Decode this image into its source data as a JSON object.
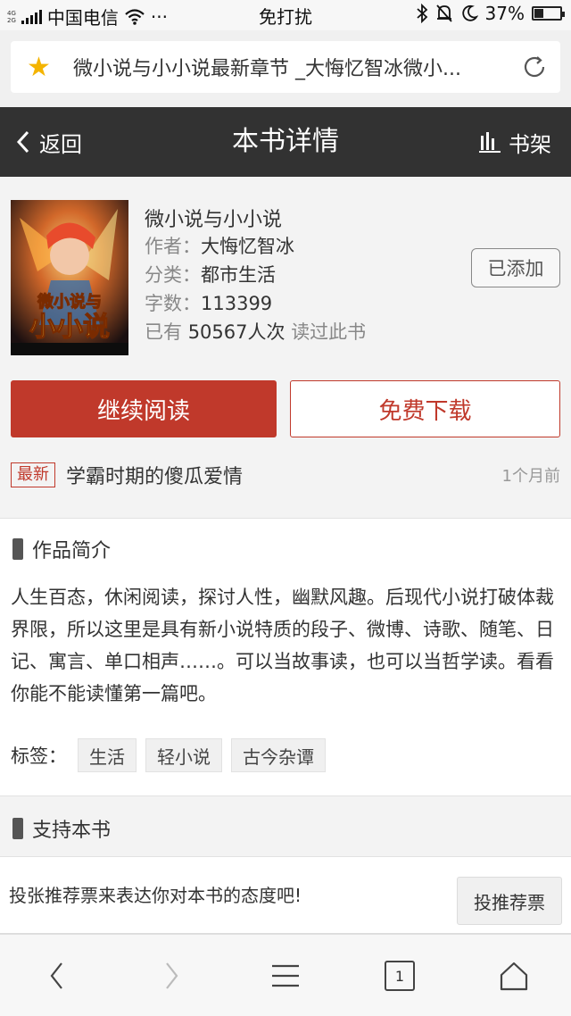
{
  "status_bar": {
    "signal_tiny": [
      "4G",
      "2G"
    ],
    "carrier": "中国电信",
    "dots": "···",
    "mode": "免打扰",
    "battery_pct": "37%",
    "battery_level": 0.37
  },
  "url_bar": {
    "title": "微小说与小小说最新章节 _大悔忆智冰微小..."
  },
  "header": {
    "back_label": "返回",
    "title": "本书详情",
    "shelf_label": "书架"
  },
  "book": {
    "title": "微小说与小小说",
    "author_label": "作者：",
    "author": "大悔忆智冰",
    "category_label": "分类：",
    "category": "都市生活",
    "words_label": "字数：",
    "words": "113399",
    "readers_prefix": "已有",
    "readers_count": "50567人次",
    "readers_suffix": "读过此书",
    "added_label": "已添加",
    "cover_title_line1": "微小说与",
    "cover_title_line2": "小小说"
  },
  "actions": {
    "continue_label": "继续阅读",
    "download_label": "免费下载"
  },
  "latest": {
    "badge": "最新",
    "chapter": "学霸时期的傻瓜爱情",
    "time": "1个月前"
  },
  "intro": {
    "heading": "作品简介",
    "text": "人生百态，休闲阅读，探讨人性，幽默风趣。后现代小说打破体裁界限，所以这里是具有新小说特质的段子、微博、诗歌、随笔、日记、寓言、单口相声……。可以当故事读，也可以当哲学读。看看你能不能读懂第一篇吧。",
    "tags_label": "标签：",
    "tags": [
      "生活",
      "轻小说",
      "古今杂谭"
    ]
  },
  "support": {
    "heading": "支持本书",
    "text": "投张推荐票来表达你对本书的态度吧!",
    "vote_label": "投推荐票"
  },
  "bottom_nav": {
    "tab_count": "1"
  },
  "colors": {
    "header_bg": "#323232",
    "accent_red": "#c0392b",
    "star": "#f4b400"
  }
}
